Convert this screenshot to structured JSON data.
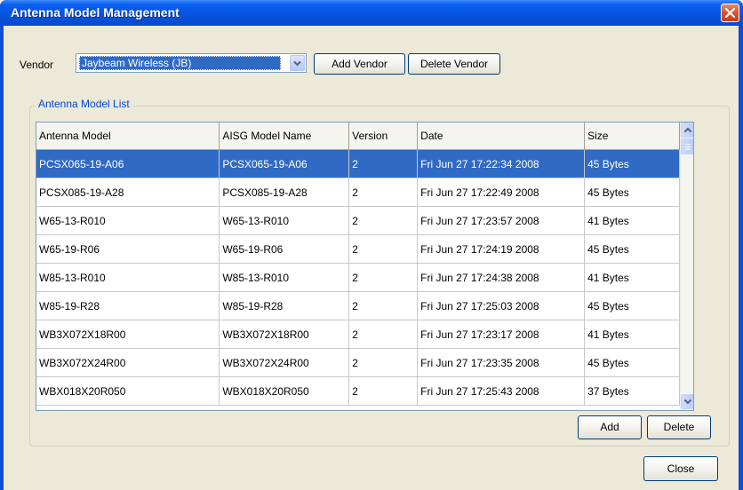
{
  "window": {
    "title": "Antenna Model Management"
  },
  "vendor": {
    "label": "Vendor",
    "selected": "Jaybeam Wireless (JB)",
    "add_label": "Add Vendor",
    "delete_label": "Delete Vendor"
  },
  "group": {
    "label": "Antenna Model List"
  },
  "table": {
    "columns": [
      "Antenna Model",
      "AISG Model Name",
      "Version",
      "Date",
      "Size"
    ],
    "rows": [
      [
        "PCSX065-19-A06",
        "PCSX065-19-A06",
        "2",
        "Fri Jun 27 17:22:34 2008",
        "45 Bytes"
      ],
      [
        "PCSX085-19-A28",
        "PCSX085-19-A28",
        "2",
        "Fri Jun 27 17:22:49 2008",
        "45 Bytes"
      ],
      [
        "W65-13-R010",
        "W65-13-R010",
        "2",
        "Fri Jun 27 17:23:57 2008",
        "41 Bytes"
      ],
      [
        "W65-19-R06",
        "W65-19-R06",
        "2",
        "Fri Jun 27 17:24:19 2008",
        "45 Bytes"
      ],
      [
        "W85-13-R010",
        "W85-13-R010",
        "2",
        "Fri Jun 27 17:24:38 2008",
        "41 Bytes"
      ],
      [
        "W85-19-R28",
        "W85-19-R28",
        "2",
        "Fri Jun 27 17:25:03 2008",
        "45 Bytes"
      ],
      [
        "WB3X072X18R00",
        "WB3X072X18R00",
        "2",
        "Fri Jun 27 17:23:17 2008",
        "41 Bytes"
      ],
      [
        "WB3X072X24R00",
        "WB3X072X24R00",
        "2",
        "Fri Jun 27 17:23:35 2008",
        "45 Bytes"
      ],
      [
        "WBX018X20R050",
        "WBX018X20R050",
        "2",
        "Fri Jun 27 17:25:43 2008",
        "37 Bytes"
      ]
    ],
    "selected_row": 0
  },
  "buttons": {
    "add_label": "Add",
    "delete_label": "Delete",
    "close_label": "Close"
  },
  "icons": {
    "close": "close-icon",
    "combo": "chevron-down-icon",
    "scroll_up": "arrow-up-icon",
    "scroll_down": "arrow-down-icon"
  },
  "colors": {
    "title_bar": "#0553e0",
    "selection": "#316ac5",
    "dialog_bg": "#ece9d8",
    "group_label": "#0046d5"
  }
}
